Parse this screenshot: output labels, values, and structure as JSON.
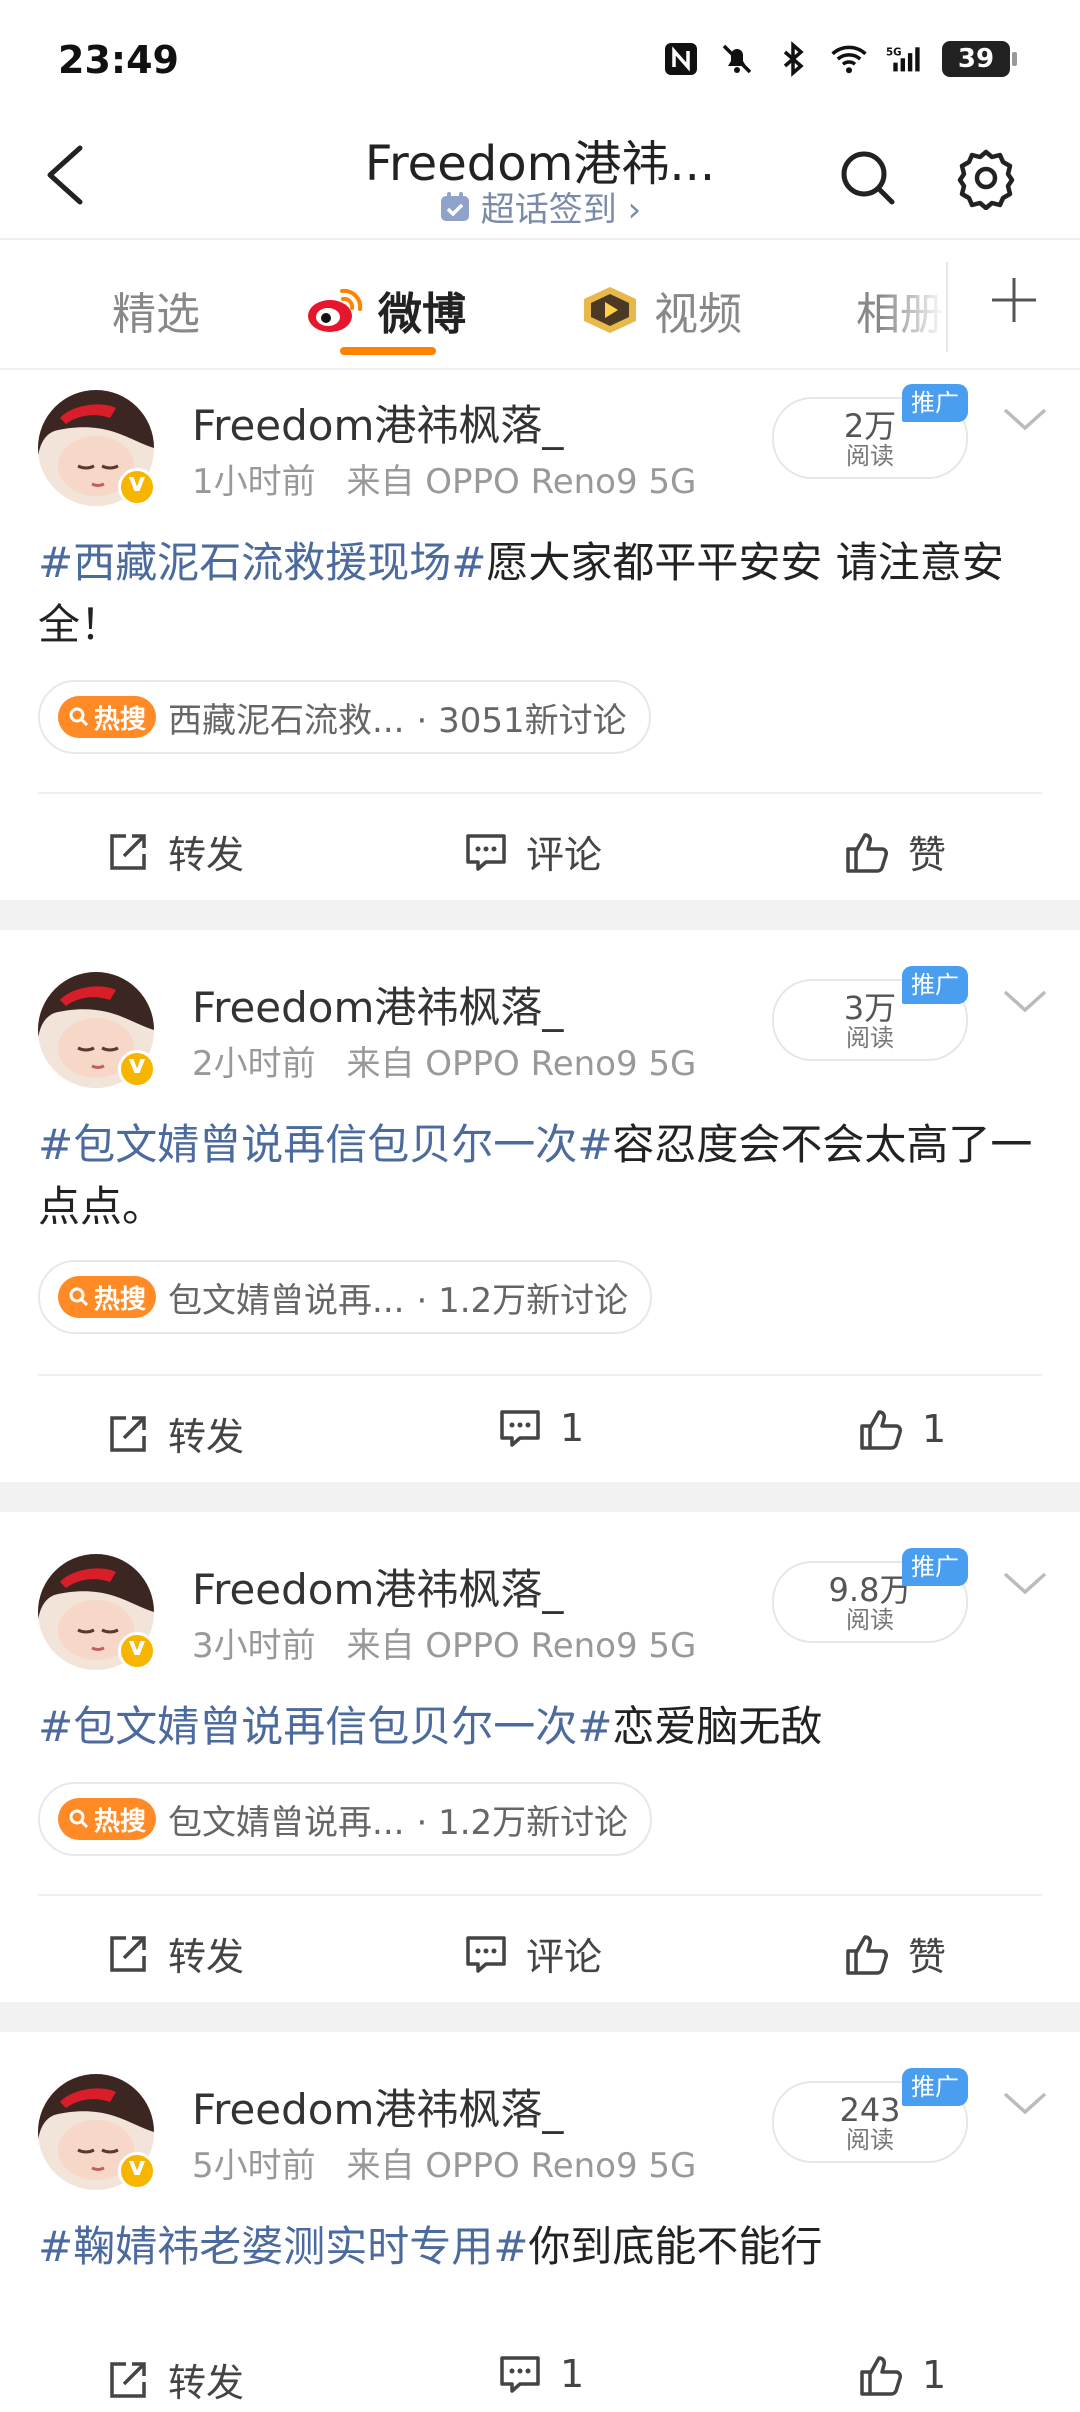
{
  "status_bar": {
    "time": "23:49",
    "battery": "39",
    "icons": [
      "nfc-icon",
      "mute-icon",
      "bluetooth-icon",
      "wifi-icon",
      "5g-signal-icon",
      "battery-icon"
    ]
  },
  "header": {
    "title": "Freedom港祎...",
    "subtitle": "超话签到 ›"
  },
  "tabs": [
    {
      "label": "精选"
    },
    {
      "label": "微博"
    },
    {
      "label": "视频"
    },
    {
      "label": "相册"
    }
  ],
  "colors": {
    "accent": "#ff8200",
    "topic": "#4b6a9d",
    "promo": "#4a9ef0",
    "hot_tag": "#ff8a26"
  },
  "posts": [
    {
      "username": "Freedom港祎枫落_",
      "time": "1小时前",
      "source": "来自 OPPO Reno9 5G",
      "reads": "2万",
      "reads_label": "阅读",
      "promo": "推广",
      "topic": "#西藏泥石流救援现场#",
      "text": "愿大家都平平安安 请注意安全！",
      "hot_label": "热搜",
      "hot_title": "西藏泥石流救...",
      "hot_count": "· 3051新讨论",
      "repost": "转发",
      "comment": "评论",
      "like": "赞"
    },
    {
      "username": "Freedom港祎枫落_",
      "time": "2小时前",
      "source": "来自 OPPO Reno9 5G",
      "reads": "3万",
      "reads_label": "阅读",
      "promo": "推广",
      "topic": "#包文婧曾说再信包贝尔一次#",
      "text": "容忍度会不会太高了一点点。",
      "hot_label": "热搜",
      "hot_title": "包文婧曾说再...",
      "hot_count": "· 1.2万新讨论",
      "repost": "转发",
      "comment": "1",
      "like": "1"
    },
    {
      "username": "Freedom港祎枫落_",
      "time": "3小时前",
      "source": "来自 OPPO Reno9 5G",
      "reads": "9.8万",
      "reads_label": "阅读",
      "promo": "推广",
      "topic": "#包文婧曾说再信包贝尔一次#",
      "text": "恋爱脑无敌",
      "hot_label": "热搜",
      "hot_title": "包文婧曾说再...",
      "hot_count": "· 1.2万新讨论",
      "repost": "转发",
      "comment": "评论",
      "like": "赞"
    },
    {
      "username": "Freedom港祎枫落_",
      "time": "5小时前",
      "source": "来自 OPPO Reno9 5G",
      "reads": "243",
      "reads_label": "阅读",
      "promo": "推广",
      "topic": "#鞠婧祎老婆测实时专用#",
      "text": "你到底能不能行",
      "repost": "转发",
      "comment": "1",
      "like": "1"
    }
  ]
}
